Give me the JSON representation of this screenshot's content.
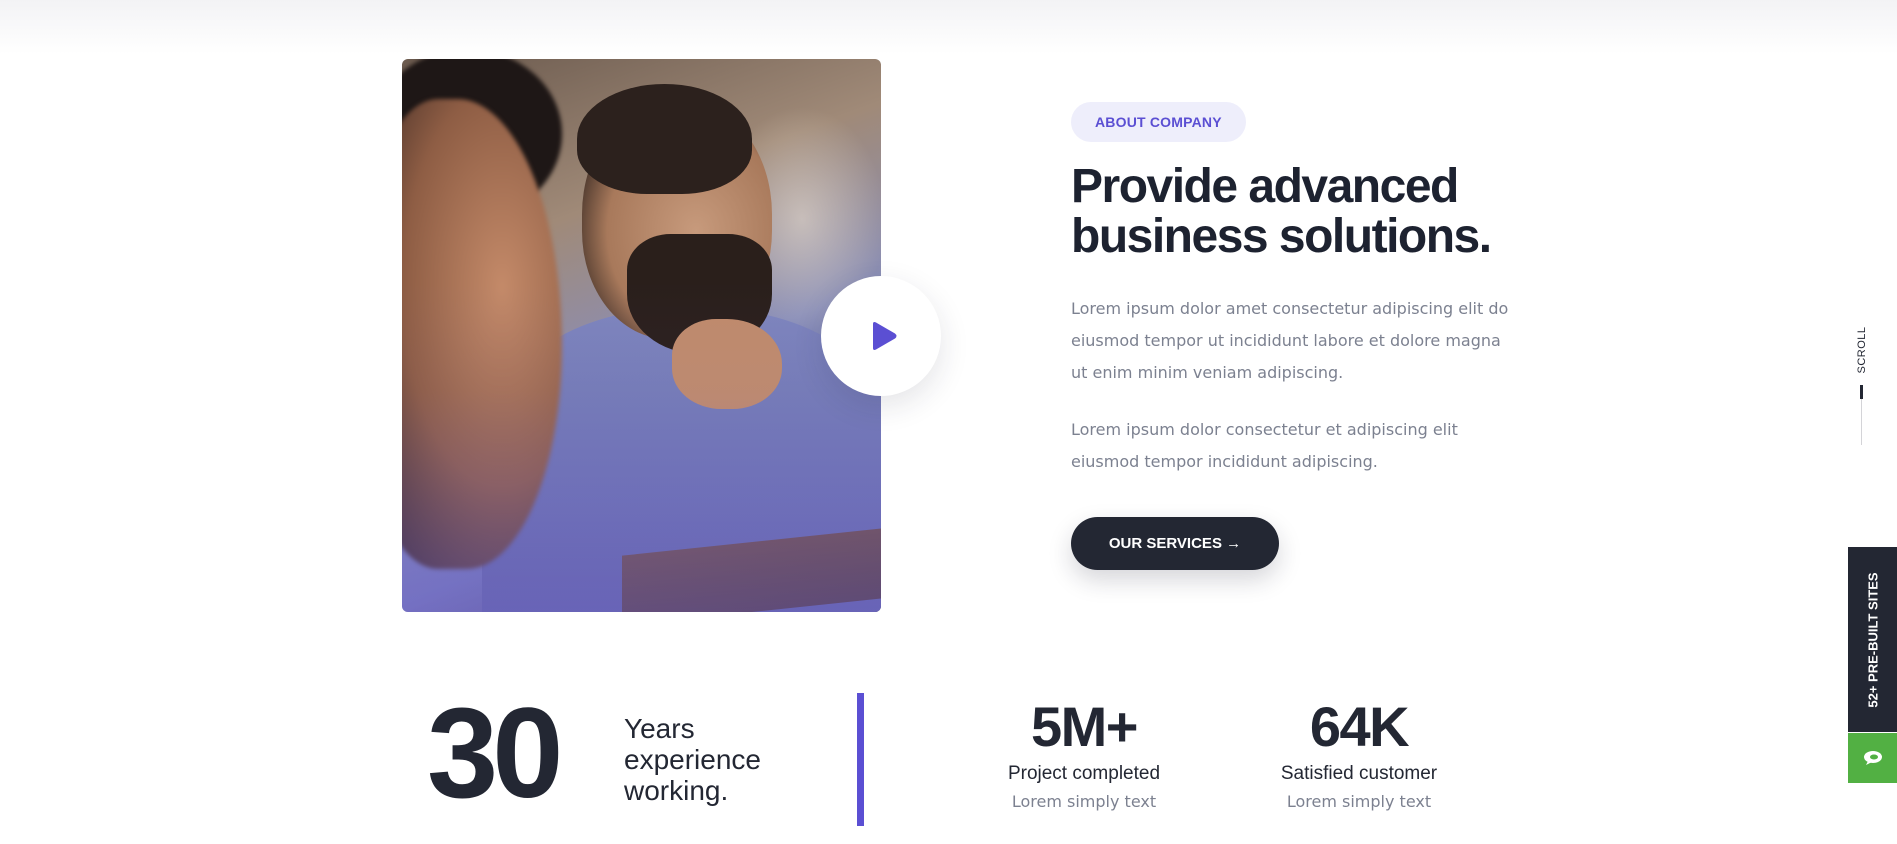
{
  "about": {
    "tag": "ABOUT COMPANY",
    "heading": "Provide advanced business solutions.",
    "paragraph_1": "Lorem ipsum dolor amet consectetur adipiscing elit do eiusmod tempor ut incididunt labore et dolore magna ut enim minim veniam adipiscing.",
    "paragraph_2": "Lorem ipsum dolor consectetur et adipiscing elit eiusmod tempor incididunt adipiscing.",
    "services_button": "OUR SERVICES →"
  },
  "experience": {
    "number": "30",
    "text": "Years experience working."
  },
  "stats": [
    {
      "value": "5M+",
      "label": "Project completed",
      "sub": "Lorem simply text"
    },
    {
      "value": "64K",
      "label": "Satisfied customer",
      "sub": "Lorem simply text"
    }
  ],
  "side": {
    "scroll_label": "SCROLL",
    "prebuilt_label": "52+ PRE-BUILT SITES"
  },
  "icons": {
    "play": "play-icon",
    "chat": "chat-bubble-icon"
  },
  "colors": {
    "accent": "#5b4fd3",
    "dark": "#232733",
    "muted": "#7c8190",
    "tag_bg": "#eeeefb",
    "chat_green": "#52b043"
  }
}
